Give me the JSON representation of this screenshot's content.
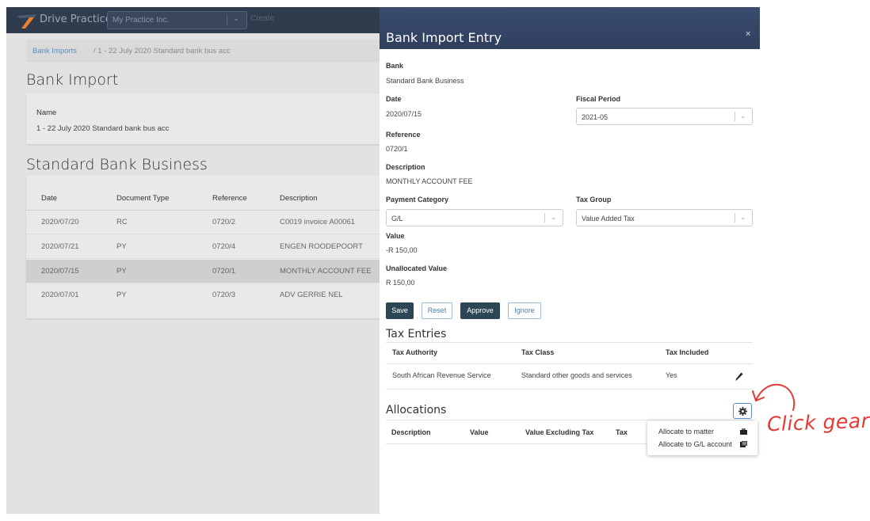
{
  "topbar": {
    "app_name": "Drive Practice",
    "company": "My Practice Inc.",
    "create_label": "Create"
  },
  "breadcrumb": {
    "link": "Bank Imports",
    "rest": "/  1 - 22 July 2020 Standard bank bus acc"
  },
  "page": {
    "title": "Bank Import",
    "name_label": "Name",
    "name_value": "1 - 22 July 2020 Standard bank bus acc",
    "section_title": "Standard Bank Business"
  },
  "imports_table": {
    "columns": [
      "Date",
      "Document Type",
      "Reference",
      "Description"
    ],
    "rows": [
      {
        "date": "2020/07/20",
        "type": "RC",
        "reference": "0720/2",
        "description": "C0019 invoice A00061"
      },
      {
        "date": "2020/07/21",
        "type": "PY",
        "reference": "0720/4",
        "description": "ENGEN ROODEPOORT"
      },
      {
        "date": "2020/07/15",
        "type": "PY",
        "reference": "0720/1",
        "description": "MONTHLY ACCOUNT FEE"
      },
      {
        "date": "2020/07/01",
        "type": "PY",
        "reference": "0720/3",
        "description": "ADV GERRIE NEL"
      }
    ]
  },
  "modal": {
    "title": "Bank Import Entry",
    "close_label": "×",
    "bank_label": "Bank",
    "bank_value": "Standard Bank Business",
    "date_label": "Date",
    "date_value": "2020/07/15",
    "fiscal_label": "Fiscal Period",
    "fiscal_value": "2021-05",
    "reference_label": "Reference",
    "reference_value": "0720/1",
    "description_label": "Description",
    "description_value": "MONTHLY ACCOUNT FEE",
    "payment_category_label": "Payment Category",
    "payment_category_value": "G/L",
    "tax_group_label": "Tax Group",
    "tax_group_value": "Value Added Tax",
    "value_label": "Value",
    "value_value": "-R 150,00",
    "unallocated_label": "Unallocated Value",
    "unallocated_value": "R 150,00",
    "buttons": {
      "save": "Save",
      "reset": "Reset",
      "approve": "Approve",
      "ignore": "Ignore"
    },
    "tax_entries": {
      "title": "Tax Entries",
      "columns": [
        "Tax Authority",
        "Tax Class",
        "Tax Included"
      ],
      "row": {
        "authority": "South African Revenue Service",
        "class": "Standard other goods and services",
        "included": "Yes"
      }
    },
    "allocations": {
      "title": "Allocations",
      "columns": [
        "Description",
        "Value",
        "Value Excluding Tax",
        "Tax"
      ],
      "menu": [
        "Allocate to matter",
        "Allocate to G/L account"
      ]
    }
  },
  "annotation": {
    "text": "Click gear",
    "color": "#e53935"
  },
  "colors": {
    "topbar": "#2f3c4e",
    "modal_header": "#34466a",
    "primary_button": "#2d4654",
    "link": "#5b8fbd"
  }
}
